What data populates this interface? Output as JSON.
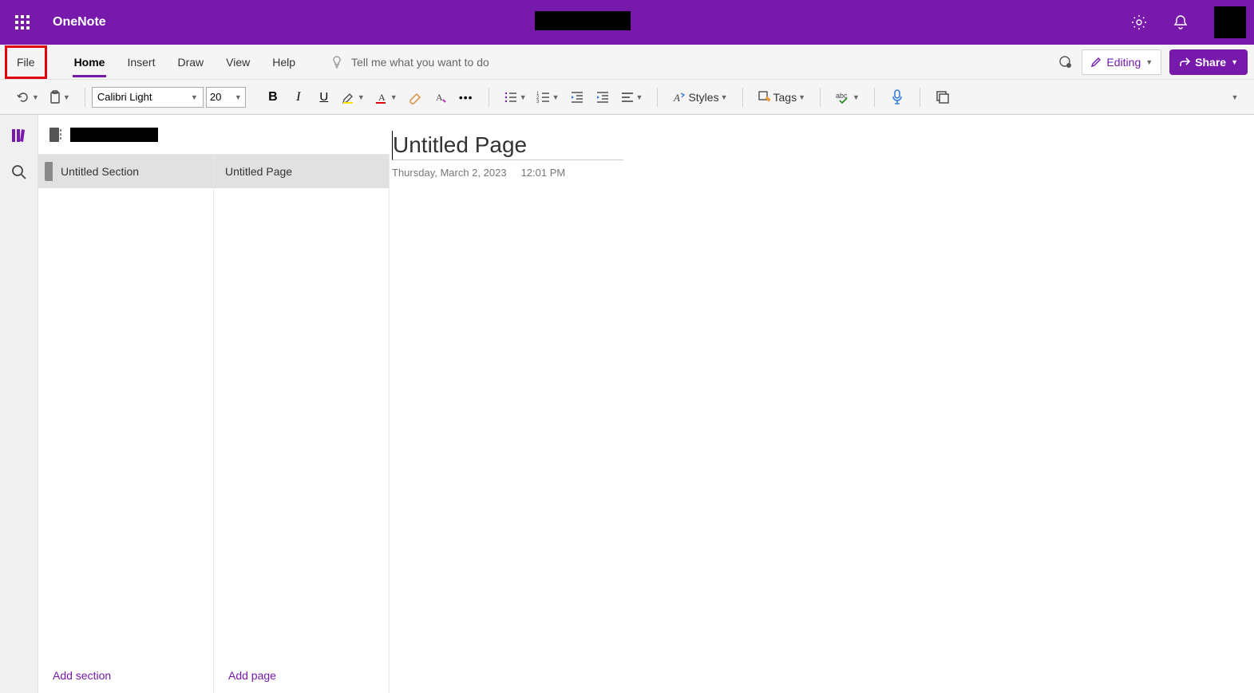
{
  "app": {
    "name": "OneNote"
  },
  "menu": {
    "file": "File",
    "home": "Home",
    "insert": "Insert",
    "draw": "Draw",
    "view": "View",
    "help": "Help",
    "tell_me_placeholder": "Tell me what you want to do",
    "editing": "Editing",
    "share": "Share"
  },
  "ribbon": {
    "font_name": "Calibri Light",
    "font_size": "20",
    "styles": "Styles",
    "tags": "Tags"
  },
  "nav": {
    "section": "Untitled Section",
    "page": "Untitled Page",
    "add_section": "Add section",
    "add_page": "Add page"
  },
  "page": {
    "title": "Untitled Page",
    "date": "Thursday, March 2, 2023",
    "time": "12:01 PM"
  }
}
